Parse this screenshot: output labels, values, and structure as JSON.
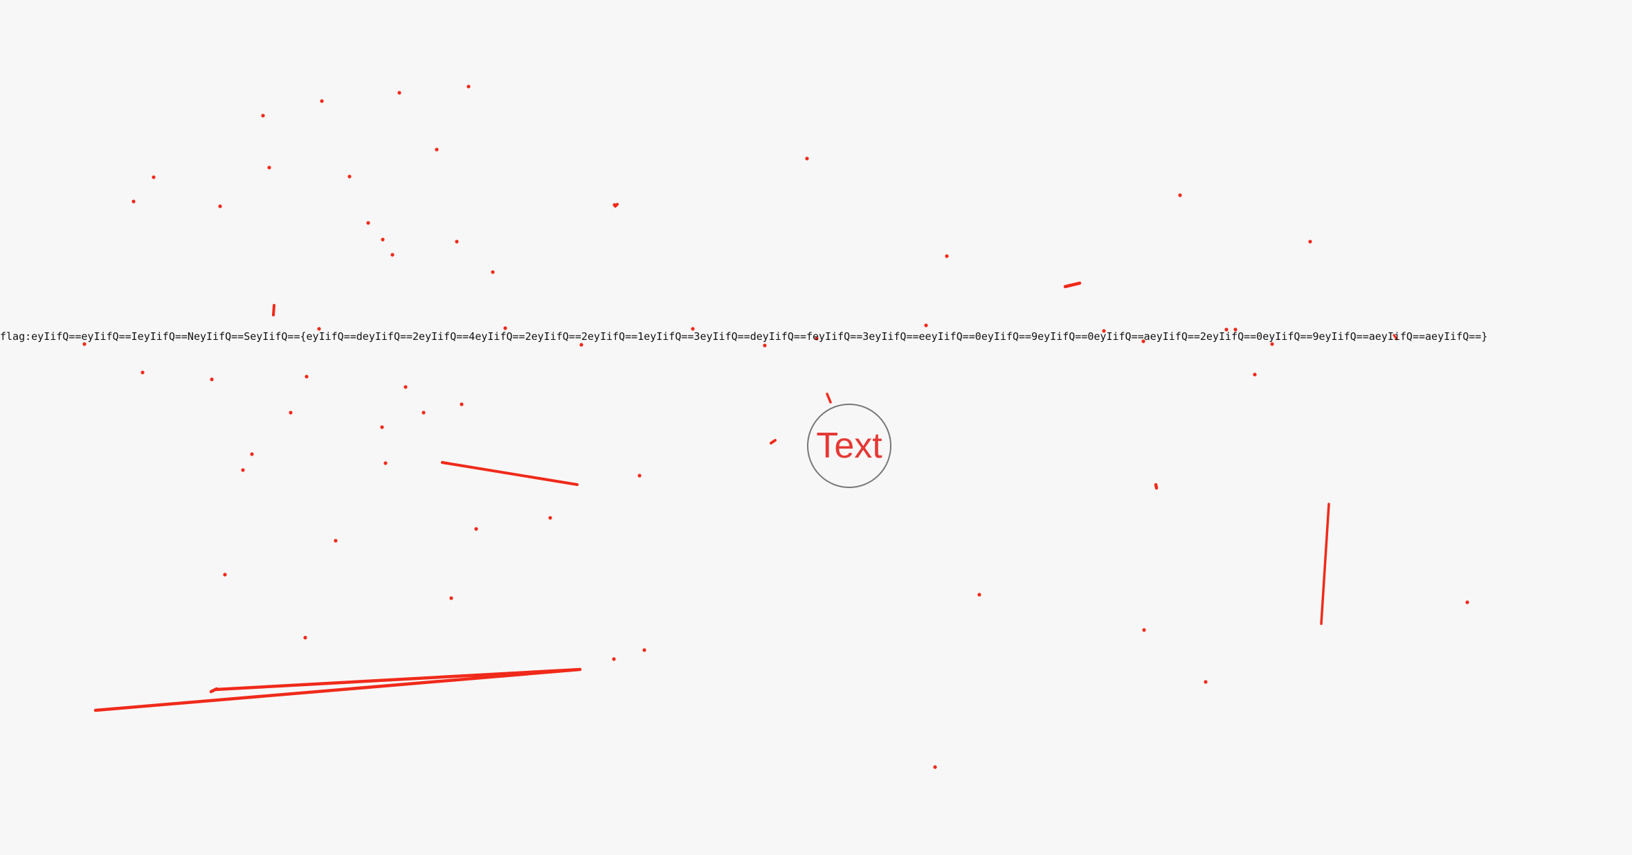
{
  "flag_text": "flag:eyIifQ==eyIifQ==IeyIifQ==NeyIifQ==SeyIifQ=={eyIifQ==deyIifQ==2eyIifQ==4eyIifQ==2eyIifQ==2eyIifQ==1eyIifQ==3eyIifQ==deyIifQ==feyIifQ==3eyIifQ==eeyIifQ==0eyIifQ==9eyIifQ==0eyIifQ==aeyIifQ==2eyIifQ==0eyIifQ==9eyIifQ==aeyIifQ==aeyIifQ==}",
  "circle_button": {
    "label": "Text"
  },
  "colors": {
    "background": "#f7f7f7",
    "stroke": "#f02a1a",
    "text": "#e53935",
    "circle_border": "#777777"
  }
}
